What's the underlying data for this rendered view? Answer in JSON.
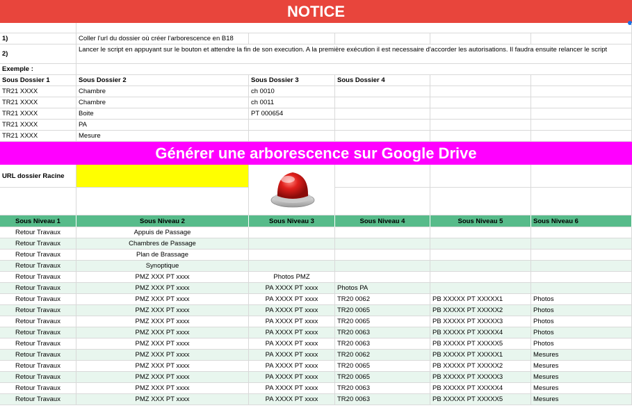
{
  "notice": {
    "title": "NOTICE"
  },
  "instructions": [
    {
      "num": "1)",
      "text": "Coller l'url du dossier où créer l'arborescence en B18"
    },
    {
      "num": "2)",
      "text": "Lancer le script en appuyant sur le bouton et attendre la fin de son execution. A la première exécution il est necessaire d'accorder les autorisations. Il faudra ensuite relancer le script"
    }
  ],
  "example": {
    "label": "Exemple :",
    "headers": [
      "Sous Dossier 1",
      "Sous Dossier 2",
      "Sous Dossier 3",
      "Sous Dossier 4"
    ],
    "rows": [
      [
        "TR21 XXXX",
        "Chambre",
        "ch 0010",
        ""
      ],
      [
        "TR21 XXXX",
        "Chambre",
        "ch 0011",
        ""
      ],
      [
        "TR21 XXXX",
        "Boite",
        "PT 000654",
        ""
      ],
      [
        "TR21 XXXX",
        "PA",
        "",
        ""
      ],
      [
        "TR21 XXXX",
        "Mesure",
        "",
        ""
      ]
    ]
  },
  "generate": {
    "title": "Générer une arborescence sur Google Drive",
    "url_label": "URL dossier Racine",
    "url_value": ""
  },
  "levels": {
    "headers": [
      "Sous Niveau 1",
      "Sous Niveau 2",
      "Sous Niveau 3",
      "Sous Niveau 4",
      "Sous Niveau 5",
      "Sous Niveau 6"
    ],
    "rows": [
      [
        "Retour Travaux",
        "Appuis de Passage",
        "",
        "",
        "",
        ""
      ],
      [
        "Retour Travaux",
        "Chambres de Passage",
        "",
        "",
        "",
        ""
      ],
      [
        "Retour Travaux",
        "Plan de Brassage",
        "",
        "",
        "",
        ""
      ],
      [
        "Retour Travaux",
        "Synoptique",
        "",
        "",
        "",
        ""
      ],
      [
        "Retour Travaux",
        "PMZ XXX PT xxxx",
        "Photos PMZ",
        "",
        "",
        ""
      ],
      [
        "Retour Travaux",
        "PMZ XXX PT xxxx",
        "PA XXXX PT xxxx",
        "Photos PA",
        "",
        ""
      ],
      [
        "Retour Travaux",
        "PMZ XXX PT xxxx",
        "PA XXXX PT xxxx",
        "TR20 0062",
        "PB XXXXX PT XXXXX1",
        "Photos"
      ],
      [
        "Retour Travaux",
        "PMZ XXX PT xxxx",
        "PA XXXX PT xxxx",
        "TR20 0065",
        "PB XXXXX PT XXXXX2",
        "Photos"
      ],
      [
        "Retour Travaux",
        "PMZ XXX PT xxxx",
        "PA XXXX PT xxxx",
        "TR20 0065",
        "PB XXXXX PT XXXXX3",
        "Photos"
      ],
      [
        "Retour Travaux",
        "PMZ XXX PT xxxx",
        "PA XXXX PT xxxx",
        "TR20 0063",
        "PB XXXXX PT XXXXX4",
        "Photos"
      ],
      [
        "Retour Travaux",
        "PMZ XXX PT xxxx",
        "PA XXXX PT xxxx",
        "TR20 0063",
        "PB XXXXX PT XXXXX5",
        "Photos"
      ],
      [
        "Retour Travaux",
        "PMZ XXX PT xxxx",
        "PA XXXX PT xxxx",
        "TR20 0062",
        "PB XXXXX PT XXXXX1",
        "Mesures"
      ],
      [
        "Retour Travaux",
        "PMZ XXX PT xxxx",
        "PA XXXX PT xxxx",
        "TR20 0065",
        "PB XXXXX PT XXXXX2",
        "Mesures"
      ],
      [
        "Retour Travaux",
        "PMZ XXX PT xxxx",
        "PA XXXX PT xxxx",
        "TR20 0065",
        "PB XXXXX PT XXXXX3",
        "Mesures"
      ],
      [
        "Retour Travaux",
        "PMZ XXX PT xxxx",
        "PA XXXX PT xxxx",
        "TR20 0063",
        "PB XXXXX PT XXXXX4",
        "Mesures"
      ],
      [
        "Retour Travaux",
        "PMZ XXX PT xxxx",
        "PA XXXX PT xxxx",
        "TR20 0063",
        "PB XXXXX PT XXXXX5",
        "Mesures"
      ]
    ]
  },
  "colors": {
    "notice_bg": "#e8453c",
    "generate_bg": "#ff00ff",
    "url_input_bg": "#ffff00",
    "level_header_bg": "#57bb8a",
    "alt_row_bg": "#e8f6ee",
    "button": "#e0201c"
  }
}
